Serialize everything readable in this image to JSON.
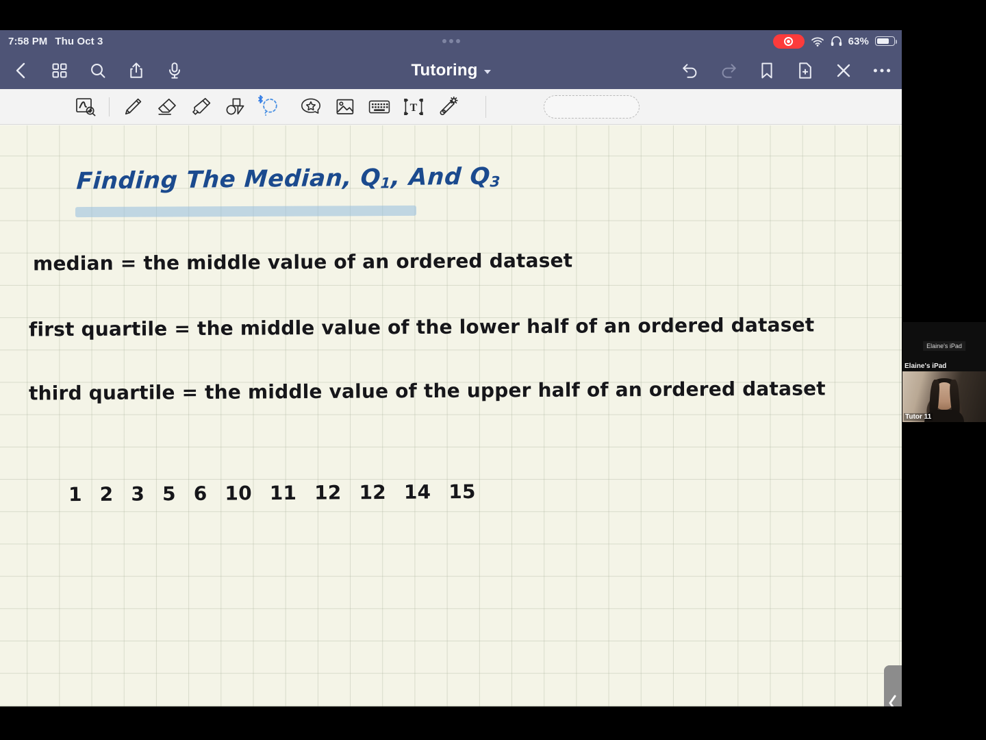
{
  "status_bar": {
    "time": "7:58 PM",
    "date": "Thu Oct 3",
    "battery_percent": "63%",
    "icons": [
      "recording-indicator",
      "wifi-icon",
      "headphones-icon",
      "battery-icon"
    ]
  },
  "nav_bar": {
    "document_title": "Tutoring",
    "left_icons": [
      "back-icon",
      "grid-icon",
      "search-icon",
      "share-icon",
      "microphone-icon"
    ],
    "right_icons": [
      "undo-icon",
      "redo-icon",
      "bookmark-icon",
      "new-page-icon",
      "close-icon",
      "more-icon"
    ]
  },
  "tool_bar": {
    "tools": [
      {
        "name": "zoom-write-icon",
        "active": false
      },
      {
        "name": "pen-icon",
        "active": false
      },
      {
        "name": "eraser-icon",
        "active": false
      },
      {
        "name": "highlighter-icon",
        "active": false
      },
      {
        "name": "shapes-icon",
        "active": false
      },
      {
        "name": "lasso-icon",
        "active": true,
        "badge": "bluetooth-icon"
      },
      {
        "name": "sticker-icon",
        "active": false
      },
      {
        "name": "image-icon",
        "active": false
      },
      {
        "name": "keyboard-icon",
        "active": false
      },
      {
        "name": "text-box-icon",
        "active": false
      },
      {
        "name": "laser-pointer-icon",
        "active": false
      }
    ],
    "drop_zone_label": ""
  },
  "note": {
    "title": "Finding The Median, Q",
    "title_sub1": "1",
    "title_mid": ", And Q",
    "title_sub2": "3",
    "lines": [
      "median =   the middle value of an ordered dataset",
      "first quartile =   the middle value of the lower half of an ordered dataset",
      "third quartile =   the middle value of the upper half of an ordered dataset"
    ],
    "dataset": [
      "1",
      "2",
      "3",
      "5",
      "6",
      "10",
      "11",
      "12",
      "12",
      "14",
      "15"
    ],
    "colors": {
      "title_ink": "#1b4a8e",
      "highlight": "#96bede",
      "body_ink": "#16161a",
      "paper": "#f4f4e7",
      "grid_line": "#aab29c"
    }
  },
  "panel": {
    "expander_icon": "chevron-left-icon"
  },
  "video_rail": {
    "tiles": [
      {
        "name": "screen-share-tile",
        "chip_label": "Elaine's iPad",
        "corner_label": "Elaine's iPad"
      },
      {
        "name": "webcam-tile",
        "corner_label": "Tutor 11"
      }
    ]
  }
}
